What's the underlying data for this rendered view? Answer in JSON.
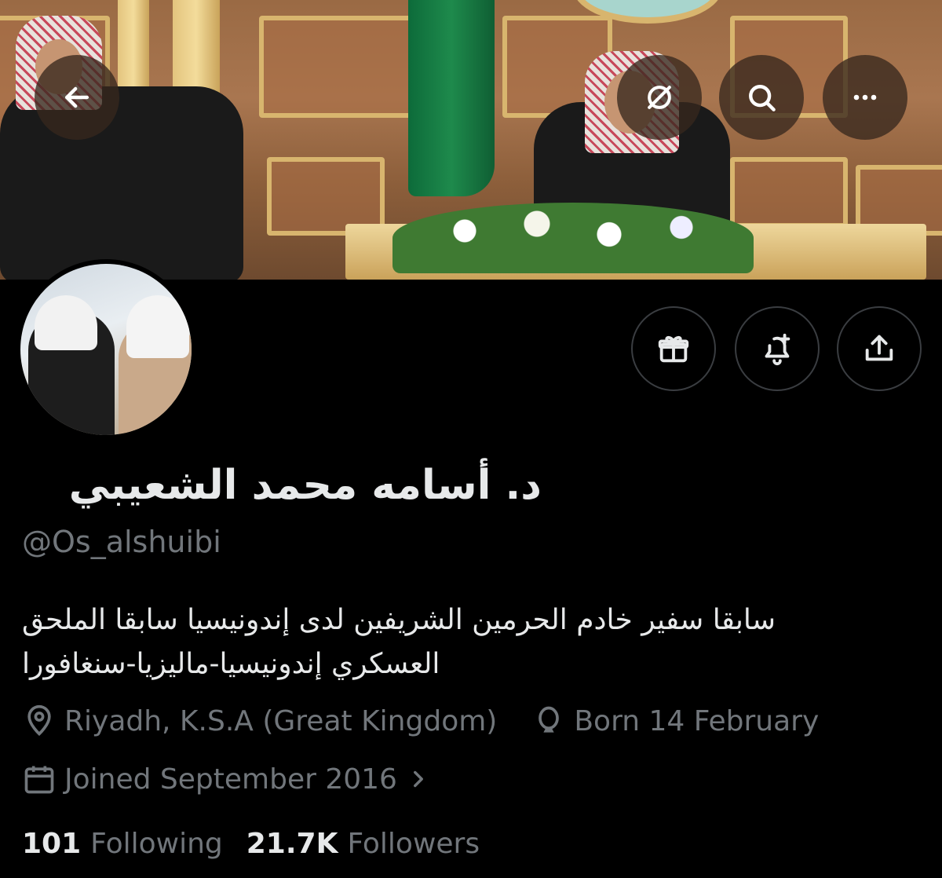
{
  "header": {
    "back_icon": "arrow-left-icon",
    "grok_icon": "grok-icon",
    "search_icon": "search-icon",
    "more_icon": "more-horizontal-icon"
  },
  "actions": {
    "gift_icon": "gift-icon",
    "notify_icon": "bell-plus-icon",
    "share_icon": "share-icon"
  },
  "profile": {
    "display_name": "د. أسامه محمد الشعيبي",
    "handle": "@Os_alshuibi",
    "bio_line1": "سابقا سفير خادم الحرمين الشريفين لدى إندونيسيا سابقا الملحق",
    "bio_line2": "العسكري إندونيسيا-ماليزيا-سنغافورا",
    "location": "Riyadh, K.S.A (Great Kingdom)",
    "birthday": "Born 14 February",
    "joined": "Joined September 2016"
  },
  "stats": {
    "following_count": "101",
    "following_label": "Following",
    "followers_count": "21.7K",
    "followers_label": "Followers"
  },
  "colors": {
    "background": "#000000",
    "primary_text": "#e7e9ea",
    "secondary_text": "#71767b",
    "button_border": "#3a3d41"
  }
}
